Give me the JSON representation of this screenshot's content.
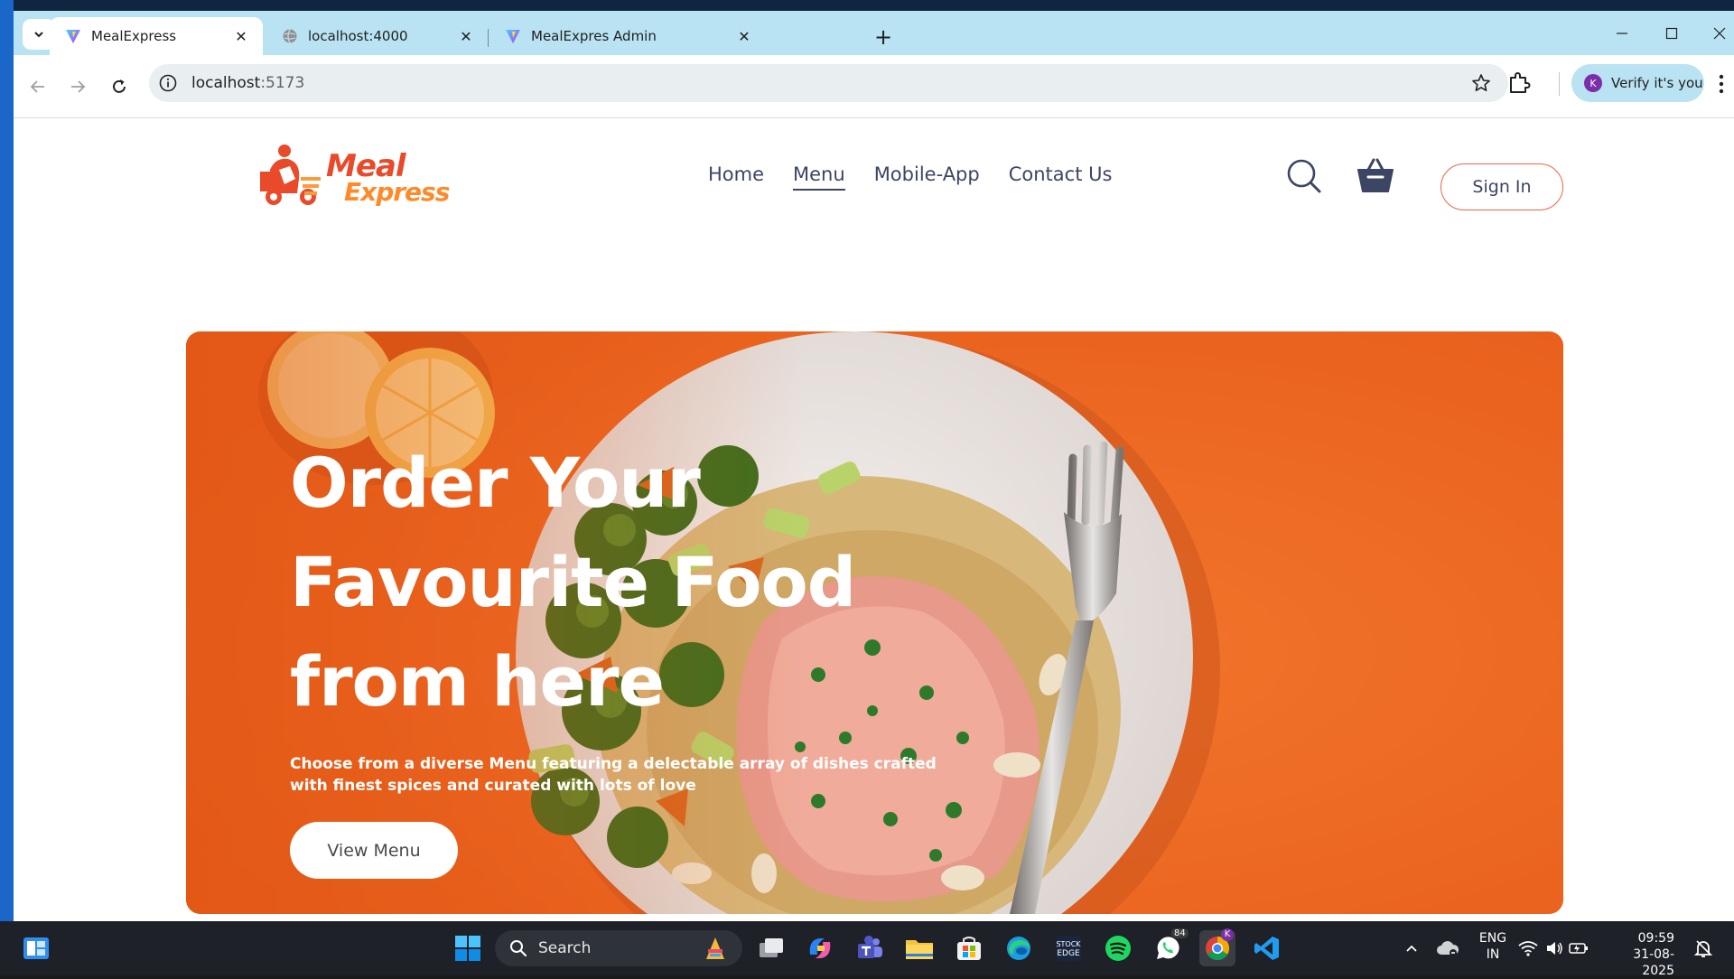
{
  "browser": {
    "tabs": [
      {
        "label": "MealExpress",
        "icon": "vite-icon",
        "active": true
      },
      {
        "label": "localhost:4000",
        "icon": "globe-icon",
        "active": false
      },
      {
        "label": "MealExpres Admin",
        "icon": "vite-icon",
        "active": false
      }
    ],
    "url_host": "localhost",
    "url_port": ":5173",
    "profile_label": "Verify it's you",
    "profile_initial": "K"
  },
  "site": {
    "logo_line1": "Meal",
    "logo_line2": "Express",
    "nav": [
      {
        "label": "Home",
        "active": false
      },
      {
        "label": "Menu",
        "active": true
      },
      {
        "label": "Mobile-App",
        "active": false
      },
      {
        "label": "Contact Us",
        "active": false
      }
    ],
    "signin_label": "Sign In",
    "accent_color": "#f0614a",
    "hero": {
      "title_line1": "Order Your",
      "title_line2": "Favourite Food",
      "title_line3": "from here",
      "description": "Choose from a diverse Menu featuring a delectable array of dishes crafted with finest spices and curated with lots of love",
      "cta_label": "View Menu",
      "bg_color": "#ef6a22"
    }
  },
  "taskbar": {
    "search_label": "Search",
    "language_line1": "ENG",
    "language_line2": "IN",
    "time": "09:59",
    "date": "31-08-2025",
    "whatsapp_badge": "84",
    "chrome_badge": "K"
  }
}
